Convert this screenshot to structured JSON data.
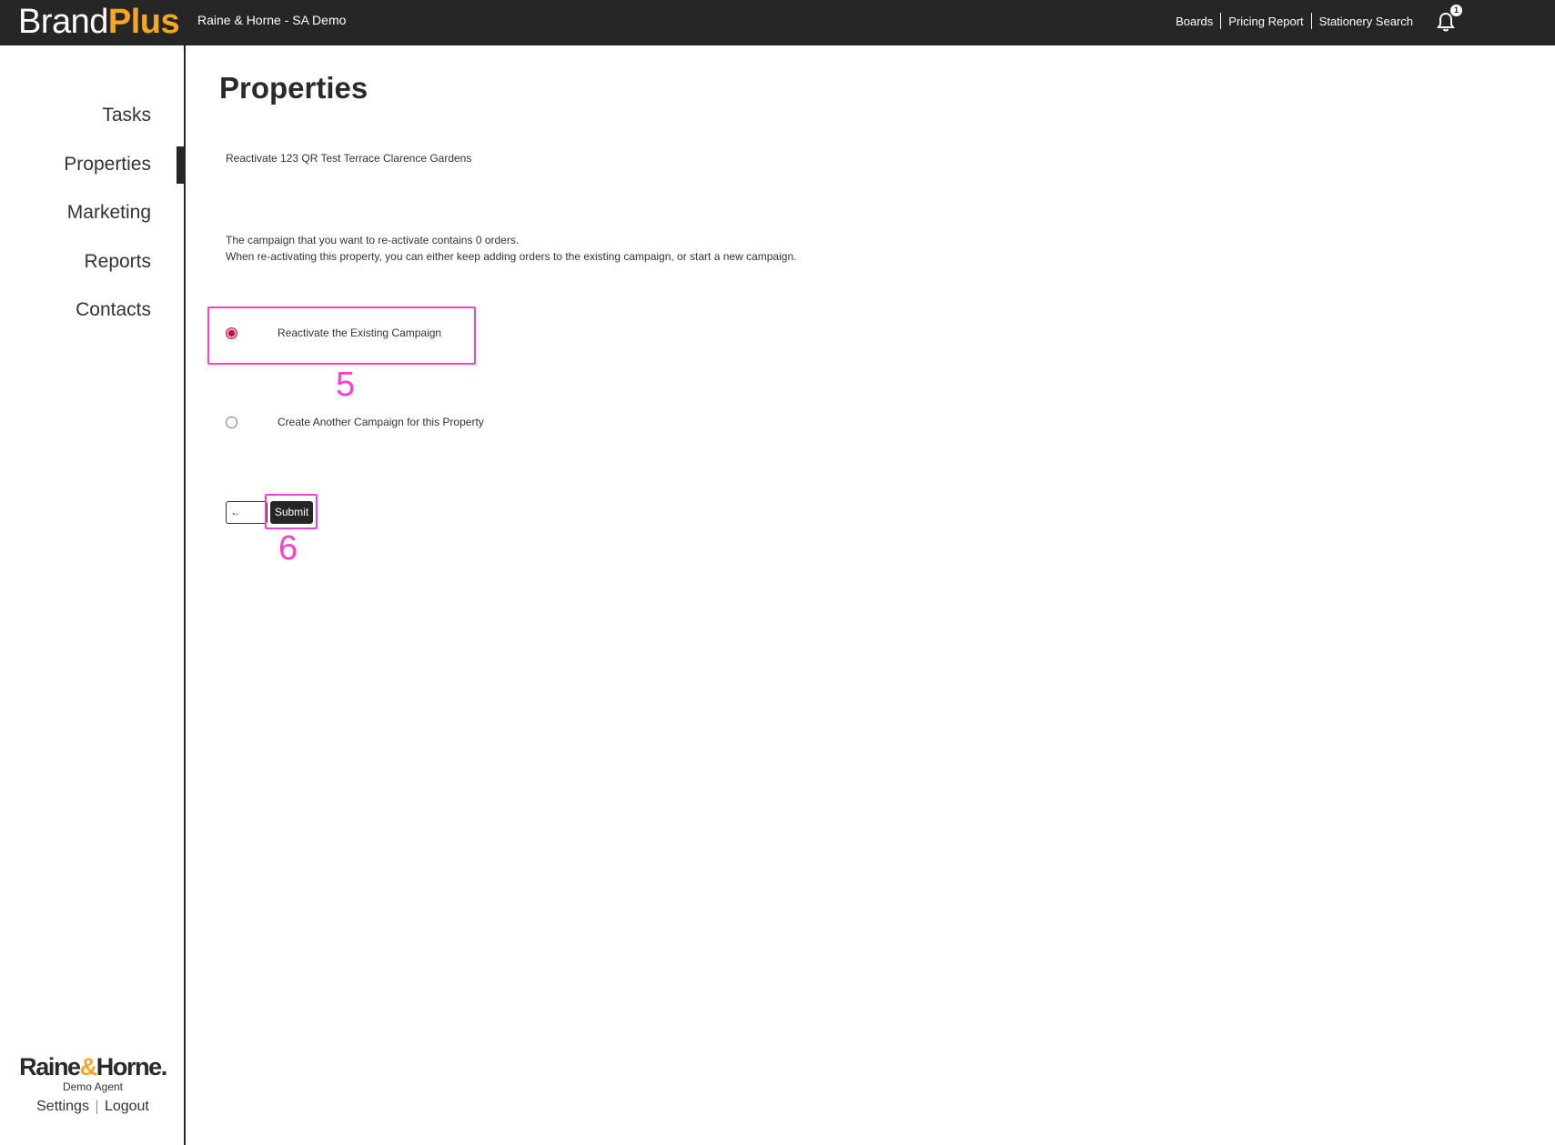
{
  "topbar": {
    "brand_part1": "Brand",
    "brand_part2": "Plus",
    "account_name": "Raine & Horne - SA Demo",
    "links": [
      "Boards",
      "Pricing Report",
      "Stationery Search"
    ],
    "notification_count": "1"
  },
  "sidebar": {
    "items": [
      {
        "label": "Tasks"
      },
      {
        "label": "Properties",
        "active": true
      },
      {
        "label": "Marketing"
      },
      {
        "label": "Reports"
      },
      {
        "label": "Contacts"
      }
    ],
    "footer": {
      "logo_part1": "Raine",
      "logo_amp": "&",
      "logo_part2": "Horne.",
      "agent": "Demo Agent",
      "settings": "Settings",
      "logout": "Logout"
    }
  },
  "main": {
    "title": "Properties",
    "reactivate_heading": "Reactivate 123 QR Test Terrace Clarence Gardens",
    "info_line1": "The campaign that you want to re-activate contains 0 orders.",
    "info_line2": "When re-activating this property, you can either keep adding orders to the existing campaign, or start a new campaign.",
    "options": [
      {
        "label": "Reactivate the Existing Campaign",
        "selected": true
      },
      {
        "label": "Create Another Campaign for this Property",
        "selected": false
      }
    ],
    "back_label": "← Back",
    "submit_label": "Submit"
  },
  "annotations": {
    "step_5": "5",
    "step_6": "6"
  },
  "colors": {
    "topbar_bg": "#262626",
    "brand_accent": "#f5a623",
    "annotation": "#ff3ec9",
    "radio_selected": "#b0183e"
  }
}
